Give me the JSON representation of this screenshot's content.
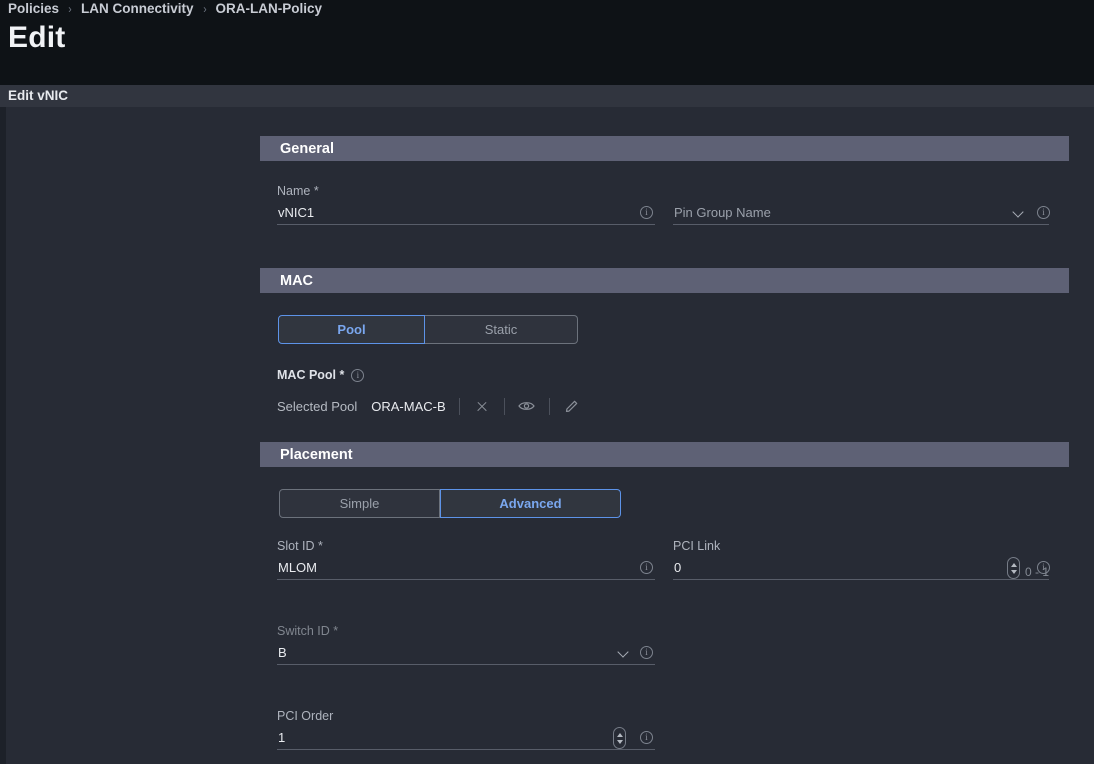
{
  "header": {
    "breadcrumb": [
      "Policies",
      "LAN Connectivity",
      "ORA-LAN-Policy"
    ],
    "separator": "›",
    "page_title": "Edit",
    "sub_title": "Edit vNIC"
  },
  "sections": {
    "general": {
      "title": "General",
      "name_label": "Name *",
      "name_value": "vNIC1",
      "pin_group_placeholder": "Pin Group Name"
    },
    "mac": {
      "title": "MAC",
      "toggle": [
        {
          "label": "Pool",
          "selected": true
        },
        {
          "label": "Static",
          "selected": false
        }
      ],
      "mac_pool_label": "MAC Pool *",
      "selected_pool_label": "Selected Pool",
      "selected_pool_value": "ORA-MAC-B",
      "actions": [
        "clear-icon",
        "view-icon",
        "edit-icon"
      ]
    },
    "placement": {
      "title": "Placement",
      "toggle": [
        {
          "label": "Simple",
          "selected": false
        },
        {
          "label": "Advanced",
          "selected": true
        }
      ],
      "slot_id_label": "Slot ID *",
      "slot_id_value": "MLOM",
      "pci_link_label": "PCI Link",
      "pci_link_value": "0",
      "pci_link_hint": "0 - 1",
      "switch_id_label": "Switch ID *",
      "switch_id_value": "B",
      "pci_order_label": "PCI Order",
      "pci_order_value": "1"
    }
  },
  "icons": {
    "info": "ⓘ",
    "info_char": "i"
  },
  "colors": {
    "accent": "#5d93e8",
    "section_bar": "#5e6175",
    "page_bg": "#272b35",
    "header_bg": "#0e1216"
  }
}
